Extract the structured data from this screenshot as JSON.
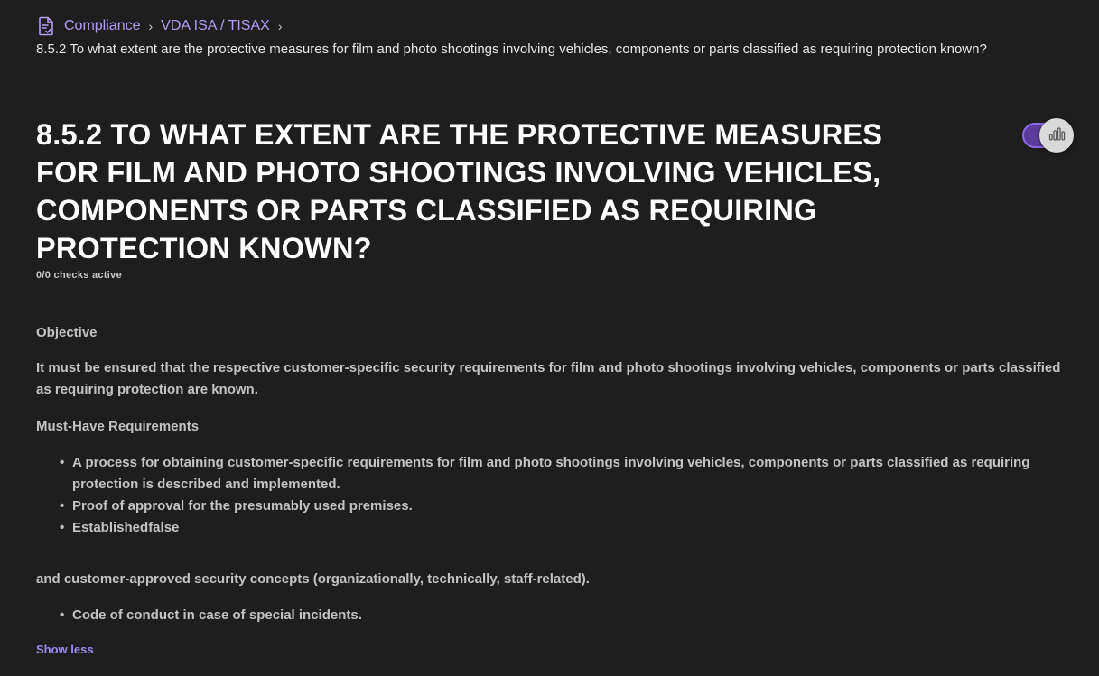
{
  "breadcrumb": {
    "icon": "compliance-document-icon",
    "items": [
      "Compliance",
      "VDA ISA / TISAX"
    ],
    "separator": "›",
    "current": "8.5.2 To what extent are the protective measures for film and photo shootings involving vehicles, components or parts classified as requiring protection known?"
  },
  "header": {
    "title": "8.5.2 To what extent are the protective measures for film and photo shootings involving vehicles, components or parts classified as requiring protection known?",
    "checks_active": "0/0 checks active",
    "toggle": {
      "state": "on",
      "knob_icon": "bar-chart-icon",
      "accent": "#8c6ae6"
    }
  },
  "content": {
    "objective_heading": "Objective",
    "objective_text": "It must be ensured that the respective customer-specific security requirements for film and photo shootings involving vehicles, components or parts classified as requiring protection are known.",
    "requirements_heading": "Must-Have Requirements",
    "requirements": [
      "A process for obtaining customer-specific requirements for film and photo shootings involving vehicles, components or parts classified as requiring protection is described and implemented.",
      "Proof of approval for the presumably used premises.",
      "Establishedfalse"
    ],
    "continuation_text": "and customer-approved security concepts (organizationally, technically, staff-related).",
    "extra_requirements": [
      "Code of conduct in case of special incidents."
    ],
    "show_less": "Show less"
  },
  "colors": {
    "background": "#1e1e1f",
    "link": "#b49cf5",
    "show_less": "#9b8cf0"
  }
}
